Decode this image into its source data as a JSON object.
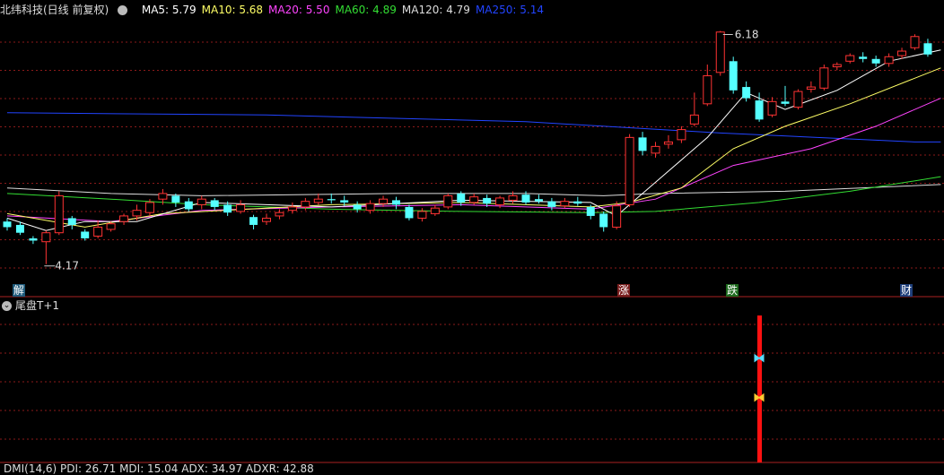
{
  "header": {
    "stock_name": "北纬科技(日线 前复权)",
    "ma_items": [
      {
        "label": "MA5: 5.79",
        "color": "#ffffff"
      },
      {
        "label": "MA10: 5.68",
        "color": "#ffff66"
      },
      {
        "label": "MA20: 5.50",
        "color": "#ff44ff"
      },
      {
        "label": "MA60: 4.89",
        "color": "#33dd33"
      },
      {
        "label": "MA120: 4.79",
        "color": "#dddddd"
      },
      {
        "label": "MA250: 5.14",
        "color": "#2244ff"
      }
    ]
  },
  "main_panel": {
    "high_label": "6.18",
    "low_label": "4.17",
    "event_markers": [
      {
        "text": "解",
        "bg": "#1e5a7a",
        "fg": "#ffffff"
      },
      {
        "text": "涨",
        "bg": "#7a1e1e",
        "fg": "#ffffff"
      },
      {
        "text": "跌",
        "bg": "#1e6a1e",
        "fg": "#ffffff"
      },
      {
        "text": "财",
        "bg": "#1e3e7a",
        "fg": "#ffffff"
      }
    ]
  },
  "sub_panel": {
    "title": "尾盘T+1",
    "signal_icons": [
      "butterfly-cyan",
      "butterfly-yellow"
    ]
  },
  "bottom_panel": {
    "label": "DMI(14,6)  PDI: 26.71  MDI: 15.04  ADX: 34.97  ADXR: 42.88"
  },
  "colors": {
    "up": "#ff3333",
    "down": "#55ffff",
    "grid": "#8b1a1a",
    "ma5": "#ffffff",
    "ma10": "#ffff66",
    "ma20": "#ff44ff",
    "ma60": "#33dd33",
    "ma120": "#dddddd",
    "ma250": "#2244ff",
    "signal_bar": "#ff1111"
  },
  "chart_data": {
    "type": "candlestick",
    "ylim": [
      4.0,
      6.35
    ],
    "candles": [
      [
        4.55,
        4.5,
        4.58,
        4.47
      ],
      [
        4.52,
        4.45,
        4.55,
        4.43
      ],
      [
        4.4,
        4.38,
        4.42,
        4.35
      ],
      [
        4.37,
        4.45,
        4.47,
        4.17
      ],
      [
        4.45,
        4.78,
        4.82,
        4.43
      ],
      [
        4.58,
        4.52,
        4.6,
        4.48
      ],
      [
        4.46,
        4.4,
        4.48,
        4.38
      ],
      [
        4.42,
        4.5,
        4.56,
        4.4
      ],
      [
        4.48,
        4.53,
        4.55,
        4.46
      ],
      [
        4.55,
        4.6,
        4.62,
        4.52
      ],
      [
        4.6,
        4.65,
        4.7,
        4.56
      ],
      [
        4.63,
        4.72,
        4.75,
        4.6
      ],
      [
        4.75,
        4.8,
        4.84,
        4.7
      ],
      [
        4.78,
        4.72,
        4.8,
        4.68
      ],
      [
        4.73,
        4.66,
        4.76,
        4.64
      ],
      [
        4.7,
        4.75,
        4.78,
        4.66
      ],
      [
        4.74,
        4.68,
        4.76,
        4.65
      ],
      [
        4.7,
        4.63,
        4.73,
        4.6
      ],
      [
        4.64,
        4.7,
        4.74,
        4.62
      ],
      [
        4.59,
        4.52,
        4.61,
        4.48
      ],
      [
        4.55,
        4.58,
        4.62,
        4.52
      ],
      [
        4.6,
        4.63,
        4.66,
        4.57
      ],
      [
        4.65,
        4.68,
        4.72,
        4.62
      ],
      [
        4.68,
        4.73,
        4.76,
        4.65
      ],
      [
        4.72,
        4.75,
        4.8,
        4.7
      ],
      [
        4.75,
        4.74,
        4.8,
        4.71
      ],
      [
        4.74,
        4.72,
        4.78,
        4.69
      ],
      [
        4.7,
        4.66,
        4.73,
        4.63
      ],
      [
        4.65,
        4.71,
        4.74,
        4.62
      ],
      [
        4.71,
        4.75,
        4.78,
        4.68
      ],
      [
        4.74,
        4.7,
        4.77,
        4.66
      ],
      [
        4.68,
        4.58,
        4.7,
        4.56
      ],
      [
        4.58,
        4.64,
        4.67,
        4.55
      ],
      [
        4.62,
        4.67,
        4.7,
        4.6
      ],
      [
        4.68,
        4.78,
        4.8,
        4.66
      ],
      [
        4.8,
        4.72,
        4.82,
        4.69
      ],
      [
        4.72,
        4.77,
        4.8,
        4.7
      ],
      [
        4.76,
        4.71,
        4.79,
        4.68
      ],
      [
        4.7,
        4.76,
        4.78,
        4.67
      ],
      [
        4.74,
        4.78,
        4.82,
        4.71
      ],
      [
        4.79,
        4.72,
        4.82,
        4.7
      ],
      [
        4.75,
        4.73,
        4.79,
        4.71
      ],
      [
        4.73,
        4.68,
        4.76,
        4.65
      ],
      [
        4.69,
        4.73,
        4.76,
        4.67
      ],
      [
        4.73,
        4.71,
        4.77,
        4.69
      ],
      [
        4.68,
        4.6,
        4.7,
        4.57
      ],
      [
        4.62,
        4.5,
        4.64,
        4.46
      ],
      [
        4.5,
        4.69,
        4.73,
        4.48
      ],
      [
        4.7,
        5.3,
        5.33,
        4.68
      ],
      [
        5.3,
        5.18,
        5.35,
        5.14
      ],
      [
        5.16,
        5.22,
        5.26,
        5.12
      ],
      [
        5.24,
        5.26,
        5.32,
        5.2
      ],
      [
        5.28,
        5.37,
        5.4,
        5.25
      ],
      [
        5.42,
        5.5,
        5.7,
        5.4
      ],
      [
        5.6,
        5.85,
        5.95,
        5.58
      ],
      [
        5.88,
        6.24,
        6.25,
        5.85
      ],
      [
        5.98,
        5.72,
        6.02,
        5.69
      ],
      [
        5.75,
        5.65,
        5.8,
        5.62
      ],
      [
        5.63,
        5.46,
        5.7,
        5.44
      ],
      [
        5.5,
        5.62,
        5.66,
        5.48
      ],
      [
        5.62,
        5.6,
        5.76,
        5.58
      ],
      [
        5.57,
        5.71,
        5.73,
        5.55
      ],
      [
        5.73,
        5.75,
        5.8,
        5.7
      ],
      [
        5.74,
        5.92,
        5.95,
        5.72
      ],
      [
        5.93,
        5.95,
        5.97,
        5.9
      ],
      [
        5.98,
        6.03,
        6.05,
        5.96
      ],
      [
        6.02,
        6.0,
        6.06,
        5.97
      ],
      [
        6.0,
        5.96,
        6.03,
        5.93
      ],
      [
        5.96,
        6.02,
        6.05,
        5.93
      ],
      [
        6.03,
        6.07,
        6.1,
        6.0
      ],
      [
        6.1,
        6.2,
        6.22,
        6.08
      ],
      [
        6.14,
        6.04,
        6.18,
        6.02
      ]
    ],
    "ma": {
      "ma250": [
        [
          0,
          5.52
        ],
        [
          20,
          5.5
        ],
        [
          40,
          5.44
        ],
        [
          55,
          5.34
        ],
        [
          70,
          5.26
        ],
        [
          72,
          5.26
        ]
      ],
      "ma120": [
        [
          0,
          4.85
        ],
        [
          8,
          4.8
        ],
        [
          15,
          4.78
        ],
        [
          30,
          4.8
        ],
        [
          40,
          4.8
        ],
        [
          46,
          4.78
        ],
        [
          50,
          4.8
        ],
        [
          60,
          4.82
        ],
        [
          72,
          4.88
        ]
      ],
      "ma60": [
        [
          0,
          4.8
        ],
        [
          8,
          4.75
        ],
        [
          15,
          4.7
        ],
        [
          25,
          4.66
        ],
        [
          35,
          4.64
        ],
        [
          45,
          4.63
        ],
        [
          50,
          4.64
        ],
        [
          58,
          4.72
        ],
        [
          65,
          4.82
        ],
        [
          72,
          4.95
        ]
      ],
      "ma20": [
        [
          0,
          4.6
        ],
        [
          8,
          4.55
        ],
        [
          15,
          4.65
        ],
        [
          25,
          4.68
        ],
        [
          35,
          4.7
        ],
        [
          45,
          4.66
        ],
        [
          50,
          4.75
        ],
        [
          56,
          5.05
        ],
        [
          62,
          5.2
        ],
        [
          67,
          5.4
        ],
        [
          72,
          5.65
        ]
      ],
      "ma10": [
        [
          0,
          4.62
        ],
        [
          6,
          4.5
        ],
        [
          12,
          4.62
        ],
        [
          25,
          4.7
        ],
        [
          35,
          4.72
        ],
        [
          45,
          4.68
        ],
        [
          48,
          4.72
        ],
        [
          52,
          4.85
        ],
        [
          56,
          5.2
        ],
        [
          60,
          5.4
        ],
        [
          65,
          5.6
        ],
        [
          72,
          5.92
        ]
      ],
      "ma5": [
        [
          0,
          4.58
        ],
        [
          3,
          4.47
        ],
        [
          6,
          4.55
        ],
        [
          10,
          4.55
        ],
        [
          15,
          4.72
        ],
        [
          25,
          4.68
        ],
        [
          35,
          4.74
        ],
        [
          45,
          4.72
        ],
        [
          47,
          4.6
        ],
        [
          50,
          4.9
        ],
        [
          54,
          5.3
        ],
        [
          57,
          5.7
        ],
        [
          60,
          5.55
        ],
        [
          64,
          5.72
        ],
        [
          68,
          5.98
        ],
        [
          72,
          6.08
        ]
      ]
    }
  }
}
